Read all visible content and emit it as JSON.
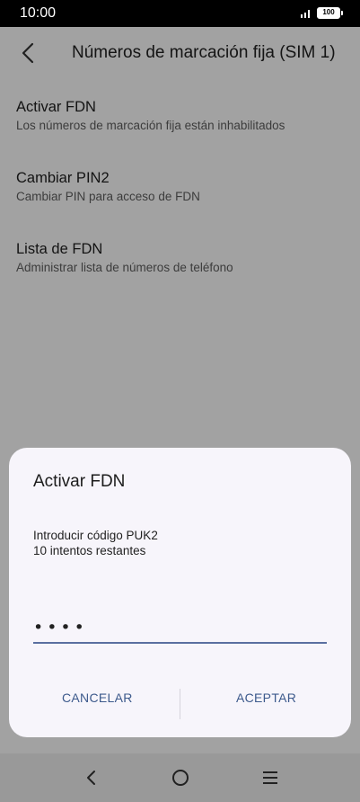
{
  "status_bar": {
    "time": "10:00",
    "battery": "100"
  },
  "toolbar": {
    "title": "Números de marcación fija (SIM 1)"
  },
  "settings": [
    {
      "title": "Activar FDN",
      "summary": "Los números de marcación fija están inhabilitados"
    },
    {
      "title": "Cambiar PIN2",
      "summary": "Cambiar PIN para acceso de FDN"
    },
    {
      "title": "Lista de FDN",
      "summary": "Administrar lista de números de teléfono"
    }
  ],
  "dialog": {
    "title": "Activar FDN",
    "message_line1": "Introducir código PUK2",
    "message_line2": "10 intentos restantes",
    "pin_value": "••••",
    "cancel_label": "CANCELAR",
    "accept_label": "ACEPTAR"
  },
  "colors": {
    "accent": "#3d5a8c",
    "underline": "#5a6fa0",
    "scrim": "#000000"
  }
}
